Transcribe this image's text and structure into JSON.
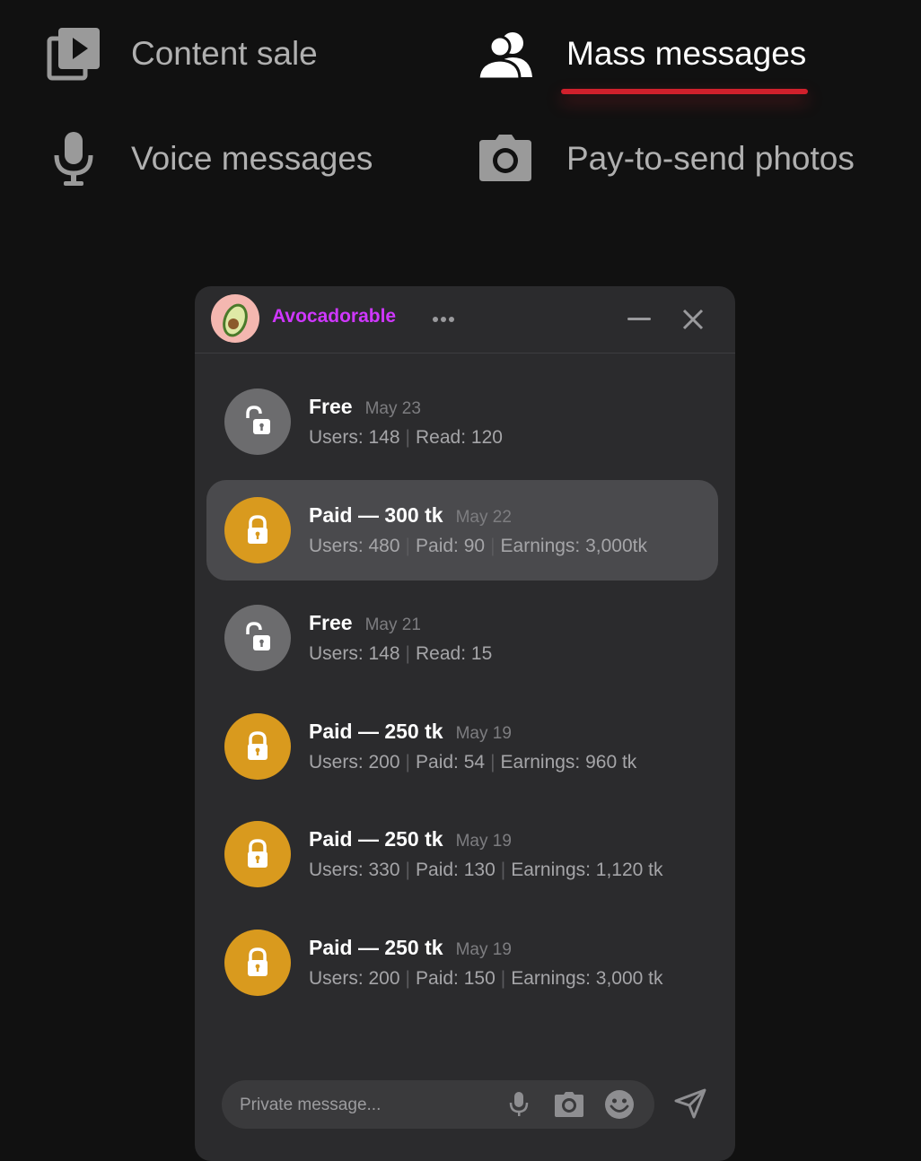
{
  "nav": {
    "items": [
      {
        "label": "Content sale",
        "icon": "video-library-icon",
        "active": false
      },
      {
        "label": "Mass messages",
        "icon": "users-icon",
        "active": true
      },
      {
        "label": "Voice messages",
        "icon": "microphone-icon",
        "active": false
      },
      {
        "label": "Pay-to-send photos",
        "icon": "camera-icon",
        "active": false
      }
    ],
    "active_color": "#d0202c"
  },
  "chat": {
    "name": "Avocadorable",
    "name_color": "#cf37ff",
    "messages": [
      {
        "title": "Free",
        "date": "May 23",
        "type": "free",
        "stats": [
          "Users: 148",
          "Read: 120"
        ],
        "selected": false
      },
      {
        "title": "Paid — 300 tk",
        "date": "May 22",
        "type": "paid",
        "stats": [
          "Users: 480",
          "Paid: 90",
          "Earnings: 3,000tk"
        ],
        "selected": true
      },
      {
        "title": "Free",
        "date": "May 21",
        "type": "free",
        "stats": [
          "Users: 148",
          "Read: 15"
        ],
        "selected": false
      },
      {
        "title": "Paid — 250 tk",
        "date": "May 19",
        "type": "paid",
        "stats": [
          "Users: 200",
          "Paid: 54",
          "Earnings: 960 tk"
        ],
        "selected": false
      },
      {
        "title": "Paid — 250 tk",
        "date": "May 19",
        "type": "paid",
        "stats": [
          "Users: 330",
          "Paid: 130",
          "Earnings: 1,120 tk"
        ],
        "selected": false
      },
      {
        "title": "Paid — 250 tk",
        "date": "May 19",
        "type": "paid",
        "stats": [
          "Users: 200",
          "Paid: 150",
          "Earnings: 3,000 tk"
        ],
        "selected": false
      }
    ],
    "composer": {
      "placeholder": "Private message...",
      "value": ""
    },
    "paid_color": "#d99a1e",
    "free_color": "#6c6c6e"
  }
}
